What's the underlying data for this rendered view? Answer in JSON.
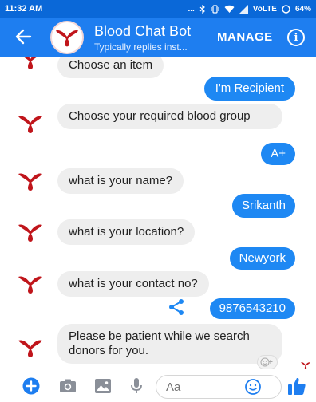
{
  "status_bar": {
    "time": "11:32 AM",
    "dots": "...",
    "network": "VoLTE",
    "battery": "64%"
  },
  "header": {
    "title": "Blood Chat Bot",
    "subtitle": "Typically replies inst...",
    "manage_label": "MANAGE",
    "info_label": "i"
  },
  "messages": [
    {
      "from": "bot",
      "text": "Choose an item"
    },
    {
      "from": "user",
      "text": "I'm Recipient"
    },
    {
      "from": "bot",
      "text": "Choose your required blood group"
    },
    {
      "from": "user",
      "text": "A+"
    },
    {
      "from": "bot",
      "text": "what is your name?"
    },
    {
      "from": "user",
      "text": "Srikanth"
    },
    {
      "from": "bot",
      "text": "what is your location?"
    },
    {
      "from": "user",
      "text": "Newyork"
    },
    {
      "from": "bot",
      "text": "what is your contact no?"
    },
    {
      "from": "user",
      "text": "9876543210"
    },
    {
      "from": "bot",
      "text": "Please be patient while we search donors for you."
    }
  ],
  "composer": {
    "placeholder": "Aa"
  },
  "colors": {
    "brand": "#1e7ef0",
    "status_bar": "#0a68d8",
    "user_bubble": "#1e88f3",
    "bot_bubble": "#eeeeee",
    "logo_red": "#c0151b"
  },
  "icons": {
    "back": "arrow-left-icon",
    "info": "info-icon",
    "share": "share-icon",
    "plus": "plus-circle-icon",
    "camera": "camera-icon",
    "gallery": "image-icon",
    "mic": "microphone-icon",
    "smile": "smile-icon",
    "like": "thumbs-up-icon"
  }
}
